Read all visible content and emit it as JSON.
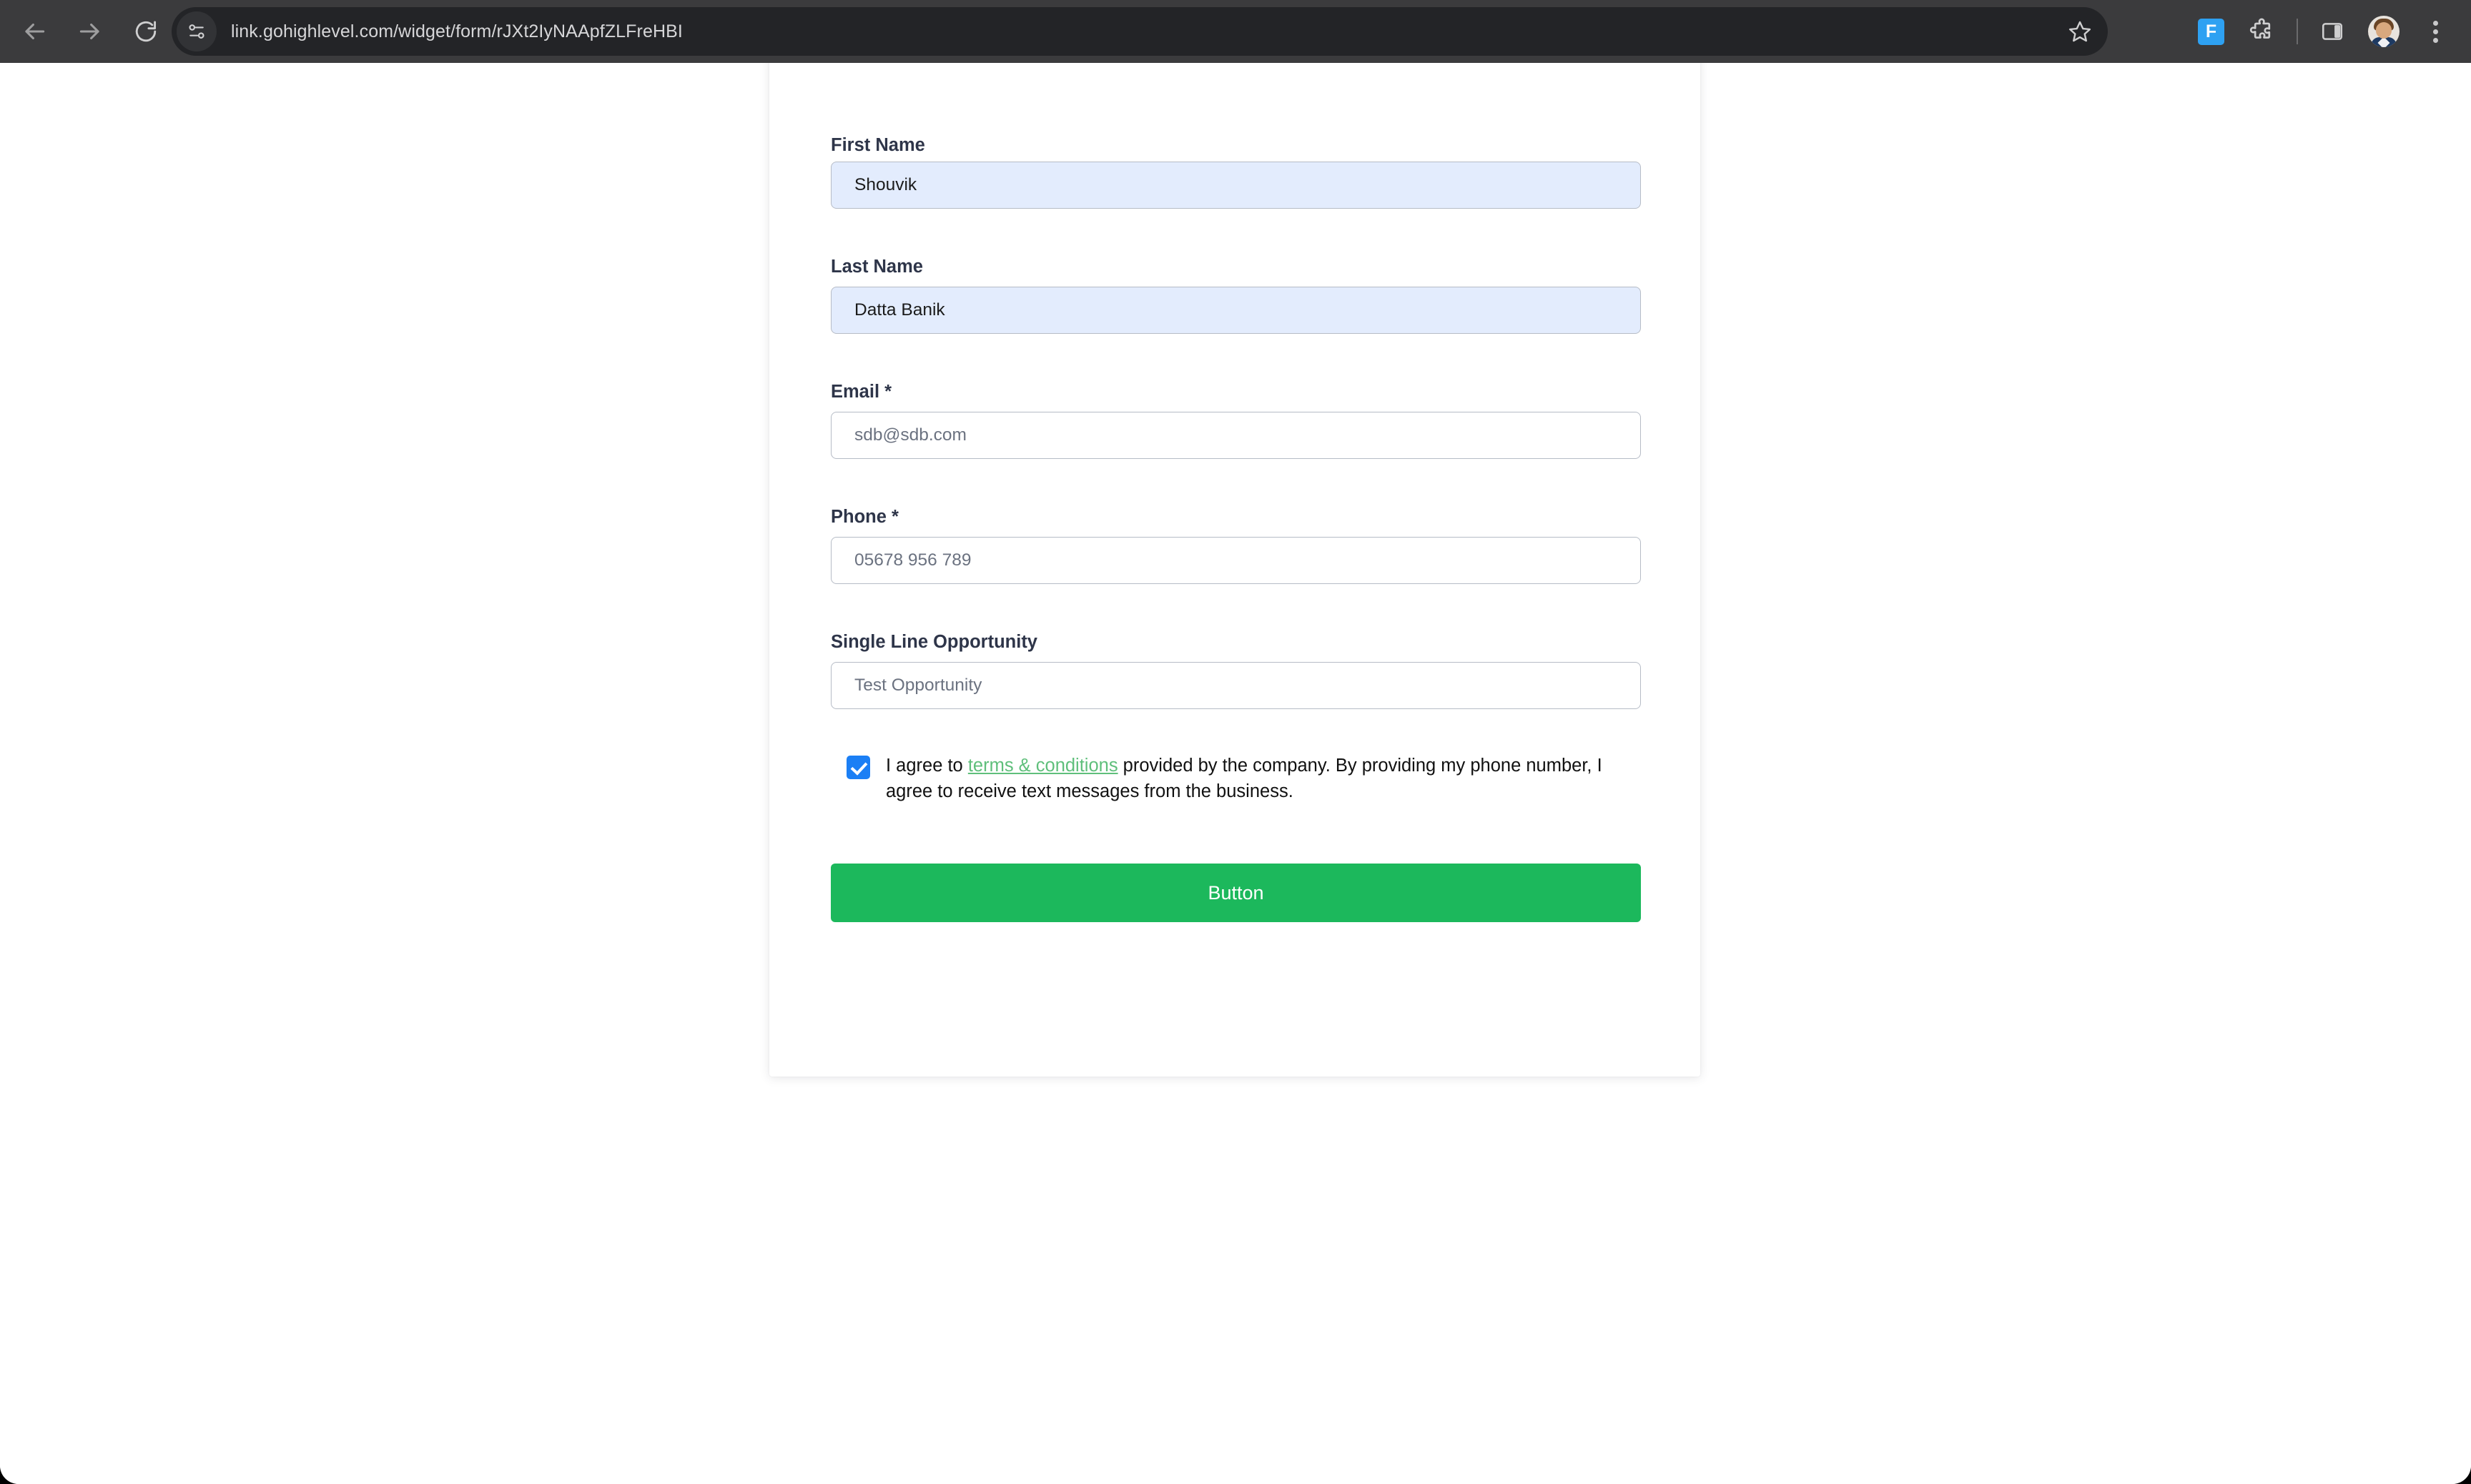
{
  "browser": {
    "url": "link.gohighlevel.com/widget/form/rJXt2IyNAApfZLFreHBI",
    "back_label": "Back",
    "forward_label": "Forward",
    "reload_label": "Reload",
    "site_info_label": "View site information",
    "bookmark_label": "Bookmark this tab",
    "extension_label": "F",
    "extensions_label": "Extensions",
    "side_panel_label": "Side panel",
    "profile_label": "Profile",
    "menu_label": "Customize and control Google Chrome"
  },
  "form": {
    "fields": [
      {
        "label": "First Name",
        "value": "Shouvik",
        "placeholder": "First Name",
        "autofilled": true
      },
      {
        "label": "Last Name",
        "value": "Datta Banik",
        "placeholder": "Last Name",
        "autofilled": true
      },
      {
        "label": "Email *",
        "value": "",
        "placeholder": "sdb@sdb.com",
        "autofilled": false
      },
      {
        "label": "Phone *",
        "value": "",
        "placeholder": "05678 956 789",
        "autofilled": false
      },
      {
        "label": "Single Line Opportunity",
        "value": "",
        "placeholder": "Test Opportunity",
        "autofilled": false
      }
    ],
    "consent": {
      "checked": true,
      "text_before": "I agree to ",
      "link_text": "terms & conditions",
      "text_after": " provided by the company. By providing my phone number, I agree to receive text messages from the business."
    },
    "submit_label": "Button"
  },
  "colors": {
    "toolbar": "#3b3b3d",
    "omnibox": "#232427",
    "accent_green": "#1cb85c",
    "link_green": "#5fbf7b",
    "checkbox_blue": "#1b7ff5",
    "autofill_blue": "#e3ecfd",
    "label_text": "#2e3549"
  }
}
